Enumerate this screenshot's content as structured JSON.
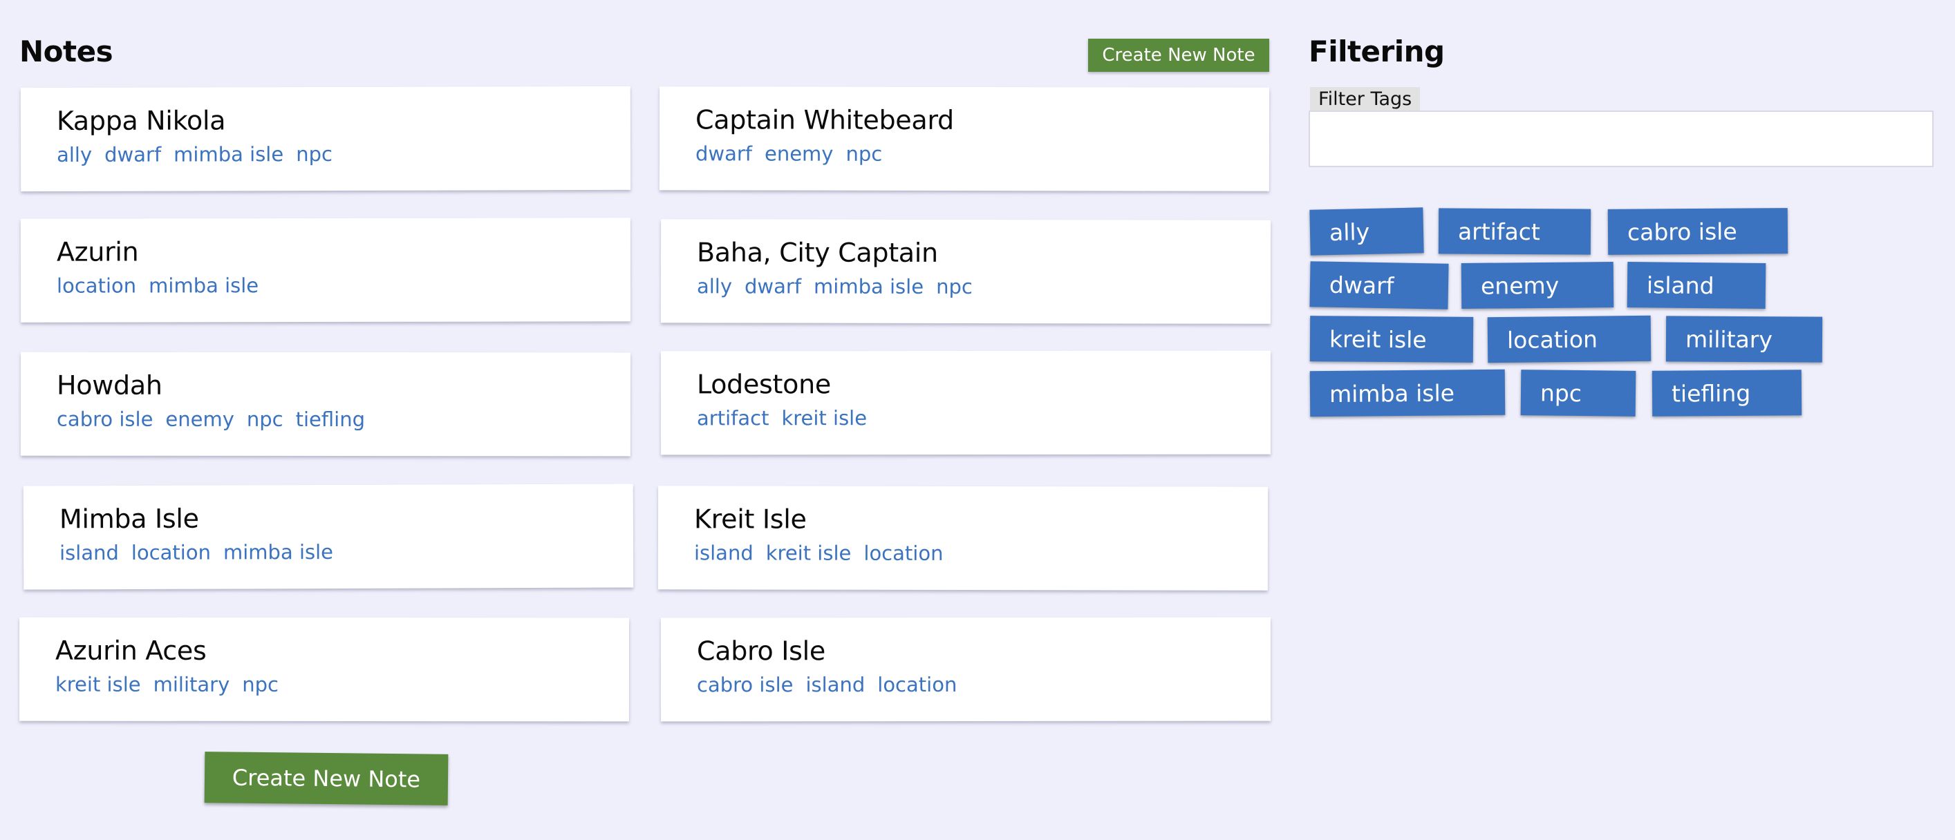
{
  "notes": {
    "title": "Notes",
    "create_top_label": "Create New Note",
    "create_bottom_label": "Create New Note",
    "cards": [
      {
        "title": "Kappa Nikola",
        "tags": [
          "ally",
          "dwarf",
          "mimba isle",
          "npc"
        ]
      },
      {
        "title": "Captain Whitebeard",
        "tags": [
          "dwarf",
          "enemy",
          "npc"
        ]
      },
      {
        "title": "Azurin",
        "tags": [
          "location",
          "mimba isle"
        ]
      },
      {
        "title": "Baha, City Captain",
        "tags": [
          "ally",
          "dwarf",
          "mimba isle",
          "npc"
        ]
      },
      {
        "title": "Howdah",
        "tags": [
          "cabro isle",
          "enemy",
          "npc",
          "tiefling"
        ]
      },
      {
        "title": "Lodestone",
        "tags": [
          "artifact",
          "kreit isle"
        ]
      },
      {
        "title": "Mimba Isle",
        "tags": [
          "island",
          "location",
          "mimba isle"
        ]
      },
      {
        "title": "Kreit Isle",
        "tags": [
          "island",
          "kreit isle",
          "location"
        ]
      },
      {
        "title": "Azurin Aces",
        "tags": [
          "kreit isle",
          "military",
          "npc"
        ]
      },
      {
        "title": "Cabro Isle",
        "tags": [
          "cabro isle",
          "island",
          "location"
        ]
      }
    ]
  },
  "filtering": {
    "title": "Filtering",
    "input_label": "Filter Tags",
    "input_value": "",
    "tags": [
      "ally",
      "artifact",
      "cabro isle",
      "dwarf",
      "enemy",
      "island",
      "kreit isle",
      "location",
      "military",
      "mimba isle",
      "npc",
      "tiefling"
    ]
  },
  "colors": {
    "background": "#efeffc",
    "accent_green": "#5a8a3c",
    "tag_blue": "#3b73c0",
    "card_bg": "#ffffff"
  }
}
